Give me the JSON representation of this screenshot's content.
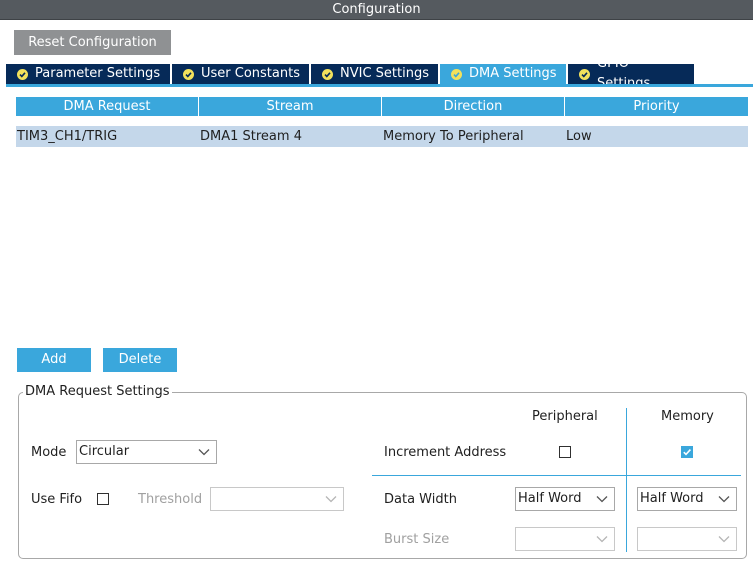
{
  "window": {
    "title": "Configuration"
  },
  "toolbar": {
    "reset_label": "Reset Configuration"
  },
  "tabs": [
    {
      "label": "Parameter Settings",
      "active": false
    },
    {
      "label": "User Constants",
      "active": false
    },
    {
      "label": "NVIC Settings",
      "active": false
    },
    {
      "label": "DMA Settings",
      "active": true
    },
    {
      "label": "GPIO Settings",
      "active": false
    }
  ],
  "table": {
    "columns": [
      "DMA Request",
      "Stream",
      "Direction",
      "Priority"
    ],
    "rows": [
      [
        "TIM3_CH1/TRIG",
        "DMA1 Stream 4",
        "Memory To Peripheral",
        "Low"
      ]
    ]
  },
  "actions": {
    "add_label": "Add",
    "delete_label": "Delete"
  },
  "settings": {
    "group_title": "DMA Request Settings",
    "peripheral_header": "Peripheral",
    "memory_header": "Memory",
    "mode_label": "Mode",
    "mode_value": "Circular",
    "increment_label": "Increment Address",
    "increment_peripheral": false,
    "increment_memory": true,
    "fifo_label": "Use Fifo",
    "use_fifo": false,
    "threshold_label": "Threshold",
    "threshold_value": "",
    "data_width_label": "Data Width",
    "data_width_peripheral": "Half Word",
    "data_width_memory": "Half Word",
    "burst_label": "Burst Size",
    "burst_peripheral": "",
    "burst_memory": ""
  },
  "colors": {
    "accent": "#3aa7dc",
    "tab_inactive": "#062a58",
    "title_bar": "#555a5f",
    "selected_row": "#c4d7ea",
    "reset_button": "#8f9193",
    "check_badge": "#f2e15c"
  },
  "icons": {
    "tab_status": "check-circle-icon",
    "dropdown": "chevron-down-icon",
    "checkbox_checked": "checkmark-icon"
  }
}
